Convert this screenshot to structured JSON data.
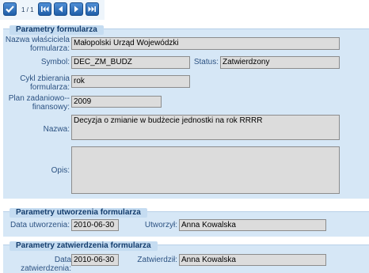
{
  "toolbar": {
    "page_indicator": "1 / 1",
    "buttons": [
      "check-icon",
      "first-page-icon",
      "prev-page-icon",
      "next-page-icon",
      "last-page-icon"
    ]
  },
  "form_params": {
    "legend": "Parametry formularza",
    "owner_label": "Nazwa właściciela formularza:",
    "owner_value": "Małopolski Urząd Wojewódzki",
    "symbol_label": "Symbol:",
    "symbol_value": "DEC_ZM_BUDZ",
    "status_label": "Status:",
    "status_value": "Zatwierdzony",
    "cycle_label": "Cykl zbierania formularza:",
    "cycle_value": "rok",
    "plan_label": "Plan zadaniowo--finansowy:",
    "plan_value": "2009",
    "name_label": "Nazwa:",
    "name_value": "Decyzja o zmianie w budżecie jednostki na rok RRRR",
    "desc_label": "Opis:",
    "desc_value": ""
  },
  "creation_params": {
    "legend": "Parametry utworzenia formularza",
    "date_label": "Data utworzenia:",
    "date_value": "2010-06-30",
    "creator_label": "Utworzył:",
    "creator_value": "Anna Kowalska"
  },
  "approval_params": {
    "legend": "Parametry zatwierdzenia formularza",
    "date_label": "Data zatwierdzenia:",
    "date_value": "2010-06-30",
    "approver_label": "Zatwierdził:",
    "approver_value": "Anna Kowalska"
  },
  "colors": {
    "panel_bg": "#d6e7f6",
    "legend_bg": "#c5dcf1",
    "field_bg": "#dcdcdc",
    "button_blue": "#2a6bb8"
  }
}
